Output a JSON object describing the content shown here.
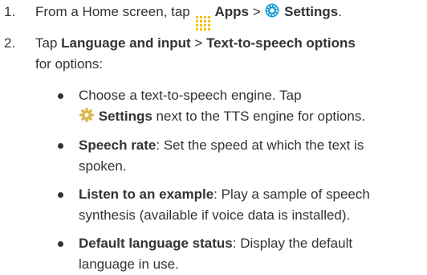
{
  "steps": [
    {
      "number": "1.",
      "prefix": "From a Home screen, tap",
      "apps_label": "Apps",
      "separator": ">",
      "settings_label": "Settings",
      "suffix": "."
    },
    {
      "number": "2.",
      "prefix": "Tap",
      "language_label": "Language and input",
      "separator": ">",
      "tts_label": "Text-to-speech options",
      "line2": "for options:"
    }
  ],
  "bullets": [
    {
      "line1": "Choose a text-to-speech engine. Tap",
      "settings_label": "Settings",
      "line2_rest": "next to the TTS engine for options."
    },
    {
      "term": "Speech rate",
      "line1_rest": ": Set the speed at which the text is",
      "line2": "spoken."
    },
    {
      "term": "Listen to an example",
      "line1_rest": ": Play a sample of speech",
      "line2": "synthesis (available if voice data is installed)."
    },
    {
      "term": "Default language status",
      "line1_rest": ": Display the default",
      "line2": "language in use."
    }
  ],
  "colors": {
    "text": "#333333",
    "apps_icon": "#f2c200",
    "settings_icon": "#1a9fd6",
    "gear_icon": "#d7b54a"
  },
  "icons": {
    "apps": "apps-grid-icon",
    "settings": "settings-gear-icon",
    "tts_settings": "gear-icon"
  }
}
